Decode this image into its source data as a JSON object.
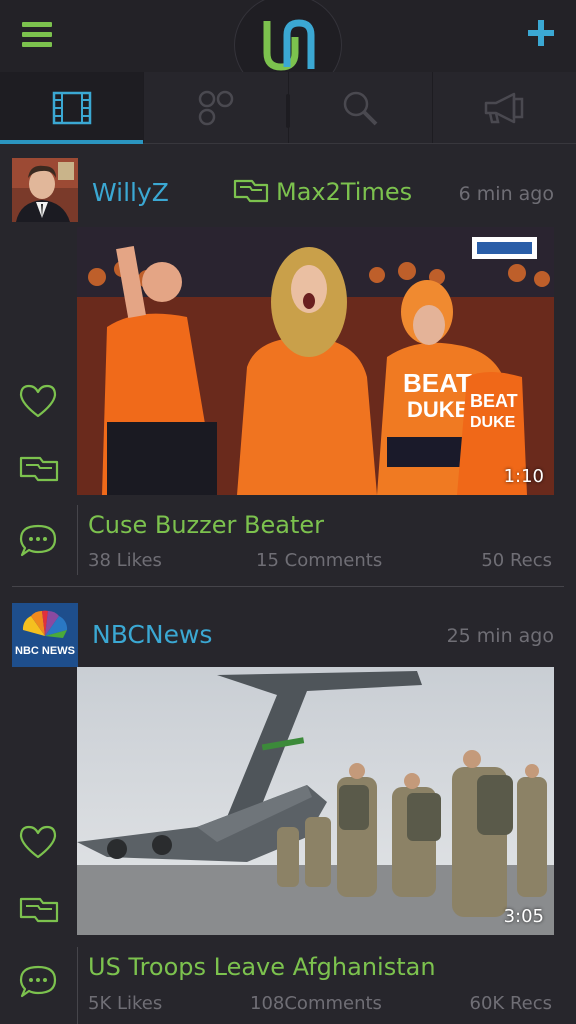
{
  "header": {
    "menu_icon": "hamburger-menu-icon",
    "logo_icon": "app-logo-icon",
    "add_icon": "plus-icon",
    "accent_green": "#7cc24e",
    "accent_blue": "#3ba8d3"
  },
  "tabs": [
    {
      "icon": "film-strip-icon",
      "active": true
    },
    {
      "icon": "circles-grid-icon",
      "active": false
    },
    {
      "icon": "search-icon",
      "active": false
    },
    {
      "icon": "megaphone-icon",
      "active": false
    }
  ],
  "posts": [
    {
      "username": "WillyZ",
      "reposted_by": "Max2Times",
      "time": "6 min ago",
      "duration": "1:10",
      "title": "Cuse Buzzer Beater",
      "likes": "38 Likes",
      "comments": "15 Comments",
      "recs": "50 Recs"
    },
    {
      "username": "NBCNews",
      "avatar_text": "NBC NEWS",
      "time": "25 min ago",
      "duration": "3:05",
      "title": "US Troops Leave Afghanistan",
      "likes": "5K Likes",
      "comments": "108Comments",
      "recs": "60K Recs"
    }
  ]
}
